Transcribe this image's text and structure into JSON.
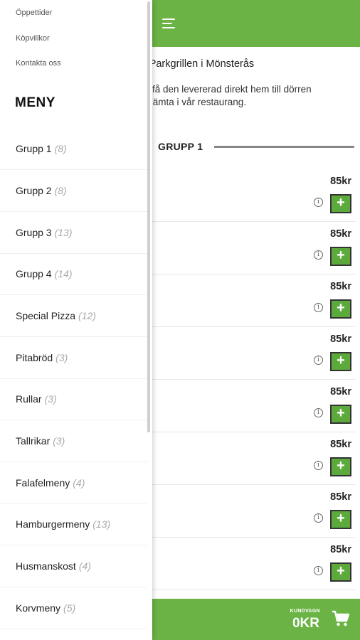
{
  "header": {
    "welcome": "ill Parkgrillen i Mönsterås",
    "intro_line1": "ch få den levererad direkt hem till dörren",
    "intro_line2": "tt hämta i vår restaurang."
  },
  "group": {
    "title": "GRUPP 1"
  },
  "products": [
    {
      "price": "85kr",
      "info_icon": "info-icon",
      "add_label": "+"
    },
    {
      "price": "85kr",
      "info_icon": "info-icon",
      "add_label": "+"
    },
    {
      "price": "85kr",
      "info_icon": "info-icon",
      "add_label": "+"
    },
    {
      "price": "85kr",
      "info_icon": "info-icon",
      "add_label": "+"
    },
    {
      "price": "85kr",
      "info_icon": "info-icon",
      "add_label": "+"
    },
    {
      "price": "85kr",
      "info_icon": "info-icon",
      "add_label": "+"
    },
    {
      "price": "85kr",
      "info_icon": "info-icon",
      "add_label": "+"
    },
    {
      "price": "85kr",
      "info_icon": "info-icon",
      "add_label": "+"
    }
  ],
  "cart": {
    "label": "KUNDVAGN",
    "total": "0KR",
    "icon": "cart-icon"
  },
  "drawer": {
    "links": [
      "Öppettider",
      "Köpvillkor",
      "Kontakta oss"
    ],
    "menu_title": "MENY",
    "categories": [
      {
        "name": "Grupp 1",
        "count": "(8)"
      },
      {
        "name": "Grupp 2",
        "count": "(8)"
      },
      {
        "name": "Grupp 3",
        "count": "(13)"
      },
      {
        "name": "Grupp 4",
        "count": "(14)"
      },
      {
        "name": "Special Pizza",
        "count": "(12)"
      },
      {
        "name": "Pitabröd",
        "count": "(3)"
      },
      {
        "name": "Rullar",
        "count": "(3)"
      },
      {
        "name": "Tallrikar",
        "count": "(3)"
      },
      {
        "name": "Falafelmeny",
        "count": "(4)"
      },
      {
        "name": "Hamburgermeny",
        "count": "(13)"
      },
      {
        "name": "Husmanskost",
        "count": "(4)"
      },
      {
        "name": "Korvmeny",
        "count": "(5)"
      }
    ]
  },
  "colors": {
    "brand_green": "#6ab344",
    "button_green": "#5daa3c"
  }
}
